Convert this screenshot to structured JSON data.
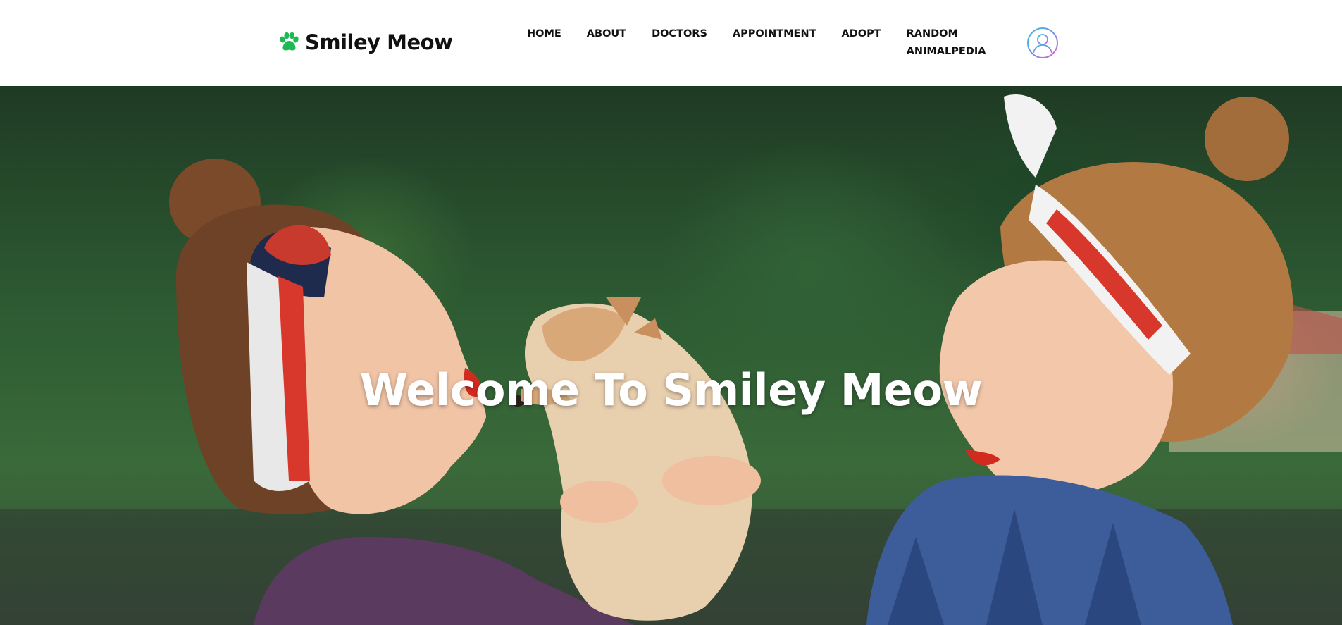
{
  "brand": {
    "name": "Smiley Meow",
    "icon": "paw-icon",
    "icon_color": "#1db954"
  },
  "nav": {
    "items": [
      {
        "label": "HOME"
      },
      {
        "label": "ABOUT"
      },
      {
        "label": "DOCTORS"
      },
      {
        "label": "APPOINTMENT"
      },
      {
        "label": "ADOPT"
      },
      {
        "label": "RANDOM ANIMALPEDIA"
      }
    ]
  },
  "profile": {
    "icon": "user-avatar-icon"
  },
  "hero": {
    "title": "Welcome To Smiley Meow",
    "image": "photo: two women with headscarves holding a fluffy pomeranian puppy outdoors"
  },
  "colors": {
    "accent": "#1db954",
    "nav_text": "#111111",
    "hero_text": "#ffffff"
  }
}
